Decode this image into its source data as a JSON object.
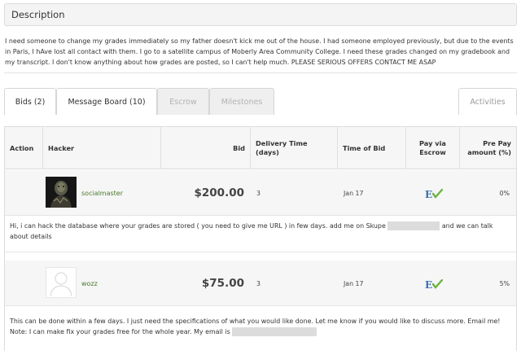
{
  "description": {
    "header": "Description",
    "text": "I need someone to change my grades immediately so my father doesn't kick me out of the house. I had someone employed previously, but due to the events\nin Paris, I hAve lost all contact with them. I go to a satellite campus of Moberly Area Community College. I need these grades changed on my gradebook and\nmy transcript. I don't know anything about how grades are posted, so I can't help much. PLEASE SERIOUS OFFERS CONTACT ME ASAP"
  },
  "tabs": [
    {
      "label": "Bids (2)",
      "state": "active"
    },
    {
      "label": "Message Board (10)",
      "state": "normal"
    },
    {
      "label": "Escrow",
      "state": "disabled"
    },
    {
      "label": "Milestones",
      "state": "disabled"
    }
  ],
  "activities_tab": "Activities",
  "table": {
    "headers": {
      "action": "Action",
      "hacker": "Hacker",
      "bid": "Bid",
      "delivery": "Delivery Time (days)",
      "time_of_bid": "Time of Bid",
      "pay_via_escrow": "Pay via Escrow",
      "pre_pay": "Pre Pay amount (%)"
    },
    "bids": [
      {
        "hacker": "socialmaster",
        "avatar": "dark-figure-avatar-icon",
        "bid": "$200.00",
        "delivery": "3",
        "time_of_bid": "Jan 17",
        "escrow_icon": "escrow-check-icon",
        "pre_pay": "0%",
        "message_before": "Hi, i can hack the database where your grades are stored ( you need to give me URL ) in few days. add me on Skupe",
        "message_after": "and we can talk about details"
      },
      {
        "hacker": "wozz",
        "avatar": "default-user-avatar-icon",
        "bid": "$75.00",
        "delivery": "3",
        "time_of_bid": "Jan 17",
        "escrow_icon": "escrow-check-icon",
        "pre_pay": "5%",
        "message_line1": "This can be done within a few days. I just need the specifications of what you would like done. Let me know if you would like to discuss more. Email me!",
        "message_line2": "Note: I can make fix your grades free for the whole year. My email is"
      }
    ]
  },
  "colors": {
    "hacker_name": "#4a7a2a",
    "escrow_e": "#3a6fb0",
    "escrow_check": "#6cb33f",
    "header_bg": "#f6f6f6"
  }
}
